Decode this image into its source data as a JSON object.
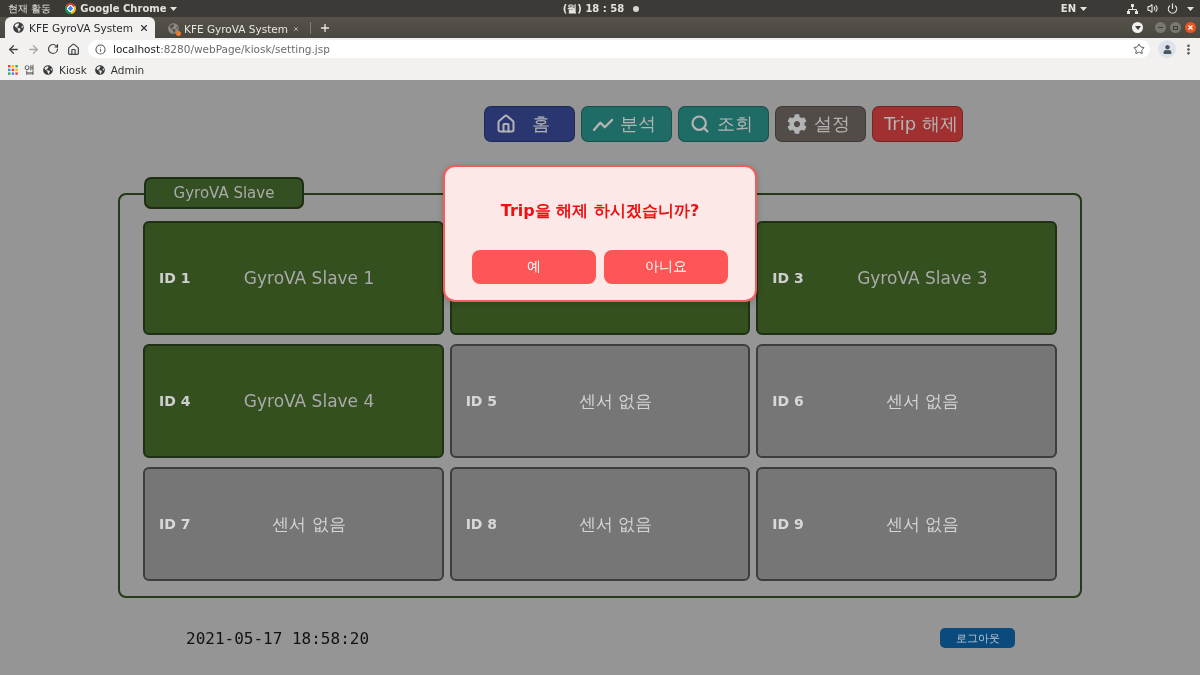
{
  "os_bar": {
    "activities": "현재 활동",
    "app_menu": "Google Chrome",
    "clock": "(월) 18 : 58",
    "keyboard": "EN"
  },
  "browser": {
    "tabs": [
      {
        "title": "KFE GyroVA System",
        "selected": true,
        "attention": false
      },
      {
        "title": "KFE GyroVA System",
        "selected": false,
        "attention": true
      }
    ],
    "address": {
      "host": "localhost",
      "rest": ":8280/webPage/kiosk/setting.jsp"
    },
    "bookmarks": [
      {
        "kind": "apps",
        "label": "앱"
      },
      {
        "kind": "site",
        "label": "Kiosk"
      },
      {
        "kind": "site",
        "label": "Admin"
      }
    ]
  },
  "nav": [
    {
      "label": "홈",
      "color": "#293670"
    },
    {
      "label": "분석",
      "color": "#1f6b66"
    },
    {
      "label": "조회",
      "color": "#1f6b66"
    },
    {
      "label": "설정",
      "color": "#524c48"
    },
    {
      "label": "Trip 해제",
      "color": "#a13030"
    }
  ],
  "panel": {
    "title": "GyroVA Slave",
    "slots": [
      {
        "id": "ID 1",
        "name": "GyroVA Slave 1",
        "connected": true
      },
      {
        "connected": true
      },
      {
        "id": "ID 3",
        "name": "GyroVA Slave 3",
        "connected": true
      },
      {
        "id": "ID 4",
        "name": "GyroVA Slave 4",
        "connected": true
      },
      {
        "id": "ID 5",
        "name": "센서 없음",
        "connected": false
      },
      {
        "id": "ID 6",
        "name": "센서 없음",
        "connected": false
      },
      {
        "id": "ID 7",
        "name": "센서 없음",
        "connected": false
      },
      {
        "id": "ID 8",
        "name": "센서 없음",
        "connected": false
      },
      {
        "id": "ID 9",
        "name": "센서 없음",
        "connected": false
      }
    ]
  },
  "footer": {
    "datetime": "2021-05-17 18:58:20",
    "logout": "로그아웃"
  },
  "dialog": {
    "message": "Trip을 해제 하시겠습니까?",
    "buttons": [
      "예",
      "아니요"
    ]
  }
}
